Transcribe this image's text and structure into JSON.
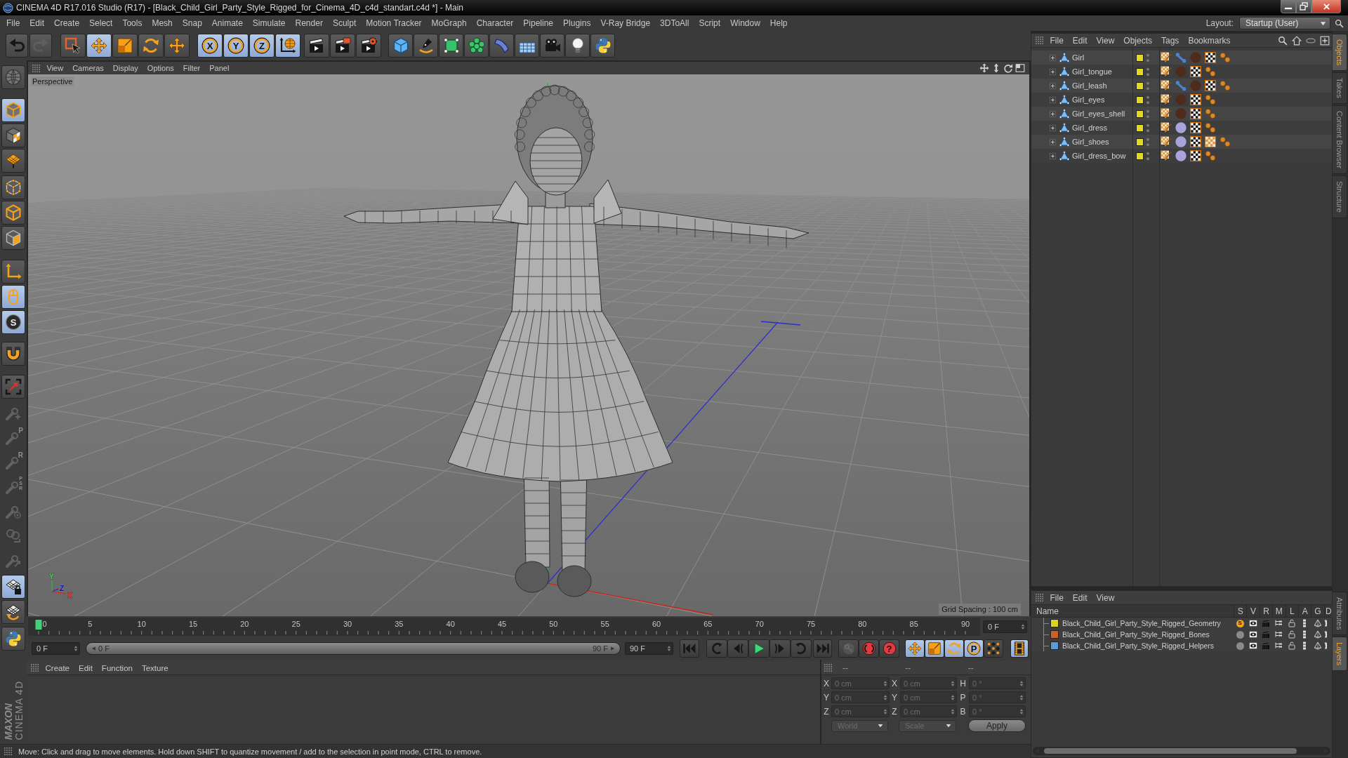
{
  "title_bar": {
    "title": "CINEMA 4D R17.016 Studio (R17) - [Black_Child_Girl_Party_Style_Rigged_for_Cinema_4D_c4d_standart.c4d *] - Main"
  },
  "menu": [
    "File",
    "Edit",
    "Create",
    "Select",
    "Tools",
    "Mesh",
    "Snap",
    "Animate",
    "Simulate",
    "Render",
    "Sculpt",
    "Motion Tracker",
    "MoGraph",
    "Character",
    "Pipeline",
    "Plugins",
    "V-Ray Bridge",
    "3DToAll",
    "Script",
    "Window",
    "Help"
  ],
  "layout": {
    "label": "Layout:",
    "value": "Startup (User)"
  },
  "toolbar": [
    {
      "active": false,
      "disabled": false
    },
    {
      "active": false,
      "disabled": true
    },
    {
      "active": false,
      "disabled": false
    },
    {
      "active": true,
      "disabled": false
    },
    {
      "active": false,
      "disabled": false
    },
    {
      "active": false,
      "disabled": false
    },
    {
      "active": false,
      "disabled": false
    },
    {
      "label": "X",
      "active": true,
      "disabled": false
    },
    {
      "label": "Y",
      "active": true,
      "disabled": false
    },
    {
      "label": "Z",
      "active": true,
      "disabled": false
    },
    {
      "active": true,
      "disabled": false
    },
    {
      "active": false,
      "disabled": false
    },
    {
      "active": false,
      "disabled": false
    },
    {
      "active": false,
      "disabled": false
    },
    {
      "active": false,
      "disabled": false
    },
    {
      "active": false,
      "disabled": false
    },
    {
      "active": false,
      "disabled": false
    },
    {
      "active": false,
      "disabled": false
    },
    {
      "active": false,
      "disabled": false
    },
    {
      "active": false,
      "disabled": false
    },
    {
      "active": false,
      "disabled": false
    },
    {
      "active": false,
      "disabled": false
    },
    {
      "active": false,
      "disabled": false
    }
  ],
  "tool_palette": [
    {
      "active": false,
      "disabled": false
    },
    {
      "active": true,
      "disabled": false
    },
    {
      "active": false,
      "disabled": false
    },
    {
      "active": false,
      "disabled": false
    },
    {
      "active": false,
      "disabled": false
    },
    {
      "active": false,
      "disabled": false
    },
    {
      "active": false,
      "disabled": false
    },
    {
      "active": false,
      "disabled": false
    },
    {
      "active": true,
      "disabled": false
    },
    {
      "label": "S",
      "active": true,
      "disabled": false
    },
    {
      "active": false,
      "disabled": false
    },
    {
      "active": false,
      "disabled": false
    },
    {
      "active": false,
      "disabled": true
    },
    {
      "label": "P",
      "active": false,
      "disabled": true
    },
    {
      "label": "R",
      "active": false,
      "disabled": true
    },
    {
      "label": "PSR",
      "active": false,
      "disabled": true
    },
    {
      "active": false,
      "disabled": true
    },
    {
      "active": false,
      "disabled": true
    },
    {
      "active": false,
      "disabled": true
    },
    {
      "active": true,
      "disabled": false
    },
    {
      "active": false,
      "disabled": false
    },
    {
      "active": false,
      "disabled": false
    }
  ],
  "logo": {
    "brand": "MAXON",
    "product": "CINEMA 4D"
  },
  "viewport": {
    "menu": [
      "View",
      "Cameras",
      "Display",
      "Options",
      "Filter",
      "Panel"
    ],
    "camera": "Perspective",
    "grid_spacing": "Grid Spacing : 100 cm",
    "axis_labels": [
      "Y",
      "Z",
      "X"
    ]
  },
  "timeline": {
    "labels": [
      "0",
      "5",
      "10",
      "15",
      "20",
      "25",
      "30",
      "35",
      "40",
      "45",
      "50",
      "55",
      "60",
      "65",
      "70",
      "75",
      "80",
      "85",
      "90"
    ],
    "level": 0,
    "current": "0 F"
  },
  "playback": {
    "start": "0 F",
    "range": {
      "start": "0 F",
      "end": "90 F",
      "level": 1
    },
    "end": "90 F",
    "buttons": [
      {
        "active": false,
        "disabled": false
      },
      {
        "active": false,
        "disabled": false
      },
      {
        "active": false,
        "disabled": false
      },
      {
        "active": false,
        "disabled": false
      },
      {
        "active": false,
        "disabled": false
      },
      {
        "active": false,
        "disabled": false
      },
      {
        "active": false,
        "disabled": false
      },
      {
        "active": false,
        "disabled": true
      },
      {
        "active": false,
        "disabled": false
      },
      {
        "label": "?",
        "active": false,
        "disabled": false
      },
      {
        "active": true,
        "disabled": false
      },
      {
        "active": true,
        "disabled": false
      },
      {
        "active": true,
        "disabled": false
      },
      {
        "label": "P",
        "active": true,
        "disabled": false
      },
      {
        "active": false,
        "disabled": false
      },
      {
        "active": true,
        "disabled": false
      }
    ]
  },
  "materials": {
    "menu": [
      "Create",
      "Edit",
      "Function",
      "Texture"
    ]
  },
  "coordinates": {
    "disabled": true,
    "headers": [
      "--",
      "--",
      "--"
    ],
    "rows": [
      [
        {
          "label": "X",
          "value": "0 cm"
        },
        {
          "label": "X",
          "value": "0 cm"
        },
        {
          "label": "H",
          "value": "0 °"
        }
      ],
      [
        {
          "label": "Y",
          "value": "0 cm"
        },
        {
          "label": "Y",
          "value": "0 cm"
        },
        {
          "label": "P",
          "value": "0 °"
        }
      ],
      [
        {
          "label": "Z",
          "value": "0 cm"
        },
        {
          "label": "Z",
          "value": "0 cm"
        },
        {
          "label": "B",
          "value": "0 °"
        }
      ]
    ],
    "dropdowns": [
      "World",
      "Scale"
    ],
    "apply": "Apply"
  },
  "status_bar": "Move: Click and drag to move elements. Hold down SHIFT to quantize movement / add to the selection in point mode, CTRL to remove.",
  "object_manager": {
    "menu": [
      "File",
      "Edit",
      "View",
      "Objects",
      "Tags",
      "Bookmarks"
    ],
    "rows": [
      {
        "name": "Girl",
        "color": "#e2d826",
        "tags": [
          {
            "kind": "weight"
          },
          {
            "kind": "bone"
          },
          {
            "kind": "material",
            "color": "#4e2c1c"
          },
          {
            "kind": "uvw"
          },
          {
            "kind": "dots"
          }
        ]
      },
      {
        "name": "Girl_tongue",
        "color": "#e2d826",
        "tags": [
          {
            "kind": "weight"
          },
          {
            "kind": "material",
            "color": "#4e2c1c"
          },
          {
            "kind": "uvw"
          },
          {
            "kind": "dots"
          }
        ]
      },
      {
        "name": "Girl_leash",
        "color": "#e2d826",
        "tags": [
          {
            "kind": "weight"
          },
          {
            "kind": "bone"
          },
          {
            "kind": "material",
            "color": "#4e2c1c"
          },
          {
            "kind": "uvw"
          },
          {
            "kind": "dots"
          }
        ]
      },
      {
        "name": "Girl_eyes",
        "color": "#e2d826",
        "tags": [
          {
            "kind": "weight"
          },
          {
            "kind": "material",
            "color": "#4e2c1c"
          },
          {
            "kind": "uvw"
          },
          {
            "kind": "dots"
          }
        ]
      },
      {
        "name": "Girl_eyes_shell",
        "color": "#e2d826",
        "tags": [
          {
            "kind": "weight"
          },
          {
            "kind": "material",
            "color": "#4e2c1c"
          },
          {
            "kind": "uvw"
          },
          {
            "kind": "dots"
          }
        ]
      },
      {
        "name": "Girl_dress",
        "color": "#e2d826",
        "tags": [
          {
            "kind": "weight"
          },
          {
            "kind": "material",
            "color": "#a9a3dc"
          },
          {
            "kind": "uvw"
          },
          {
            "kind": "dots"
          }
        ]
      },
      {
        "name": "Girl_shoes",
        "color": "#e2d826",
        "tags": [
          {
            "kind": "weight"
          },
          {
            "kind": "material",
            "color": "#a9a3dc"
          },
          {
            "kind": "uvw"
          },
          {
            "kind": "pattern"
          },
          {
            "kind": "dots"
          }
        ]
      },
      {
        "name": "Girl_dress_bow",
        "color": "#e2d826",
        "tags": [
          {
            "kind": "weight"
          },
          {
            "kind": "material",
            "color": "#a9a3dc"
          },
          {
            "kind": "uvw"
          },
          {
            "kind": "dots"
          }
        ]
      }
    ]
  },
  "layer_manager": {
    "menu": [
      "File",
      "Edit",
      "View"
    ],
    "columns": [
      "Name",
      "S",
      "V",
      "R",
      "M",
      "L",
      "A",
      "G",
      "D"
    ],
    "rows": [
      {
        "name": "Black_Child_Girl_Party_Style_Rigged_Geometry",
        "color": "#dcd41e",
        "solo": true,
        "solo_label": "S"
      },
      {
        "name": "Black_Child_Girl_Party_Style_Rigged_Bones",
        "color": "#c8612c",
        "solo": false
      },
      {
        "name": "Black_Child_Girl_Party_Style_Rigged_Helpers",
        "color": "#5d9ad6",
        "solo": false
      }
    ]
  },
  "side_tabs": {
    "top": [
      {
        "label": "Objects",
        "selected": true
      },
      {
        "label": "Takes",
        "selected": false
      },
      {
        "label": "Content Browser",
        "selected": false
      },
      {
        "label": "Structure",
        "selected": false
      }
    ],
    "bottom": [
      {
        "label": "Attributes",
        "selected": false
      },
      {
        "label": "Layers",
        "selected": true
      }
    ]
  }
}
